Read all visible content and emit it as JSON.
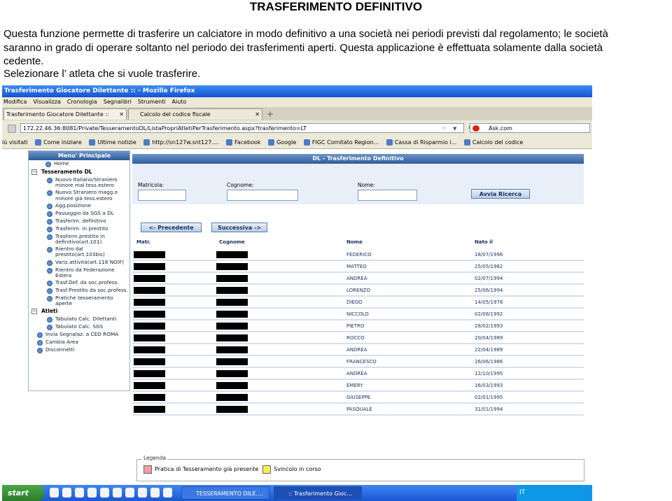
{
  "document": {
    "title": "TRASFERIMENTO DEFINITIVO",
    "paragraph_lines": [
      "Questa funzione permette di trasferire un calciatore in modo definitivo a una società nei periodi previsti dal regolamento; le società",
      "saranno in grado di operare soltanto nel periodo dei trasferimenti aperti. Questa applicazione è effettuata solamente dalla società",
      "cedente."
    ],
    "instruction": "Selezionare l’ atleta che si vuole trasferire."
  },
  "browser": {
    "window_title": "Trasferimento Giocatore Dilettante :: - Mozilla Firefox",
    "menu": [
      "Modifica",
      "Visualizza",
      "Cronologia",
      "Segnalibri",
      "Strumenti",
      "Aiuto"
    ],
    "tabs": [
      {
        "label": "Trasferimento Giocatore Dilettante ::",
        "close": "✕"
      },
      {
        "label": "Calcolo del codice fiscale",
        "close": "✕"
      }
    ],
    "url": "172.22.46.36:8081/Private/TesseramentoDL/ListaPropriAtletiPerTrasferimento.aspx?trasferimento=LT",
    "search_text": "Ask.com",
    "bookmarks": [
      "iù visitati",
      "Come iniziare",
      "Ultime notizie",
      "http://sn127w.snt127....",
      "Facebook",
      "Google",
      "FIGC Comitato Region...",
      "Cassa di Risparmio i...",
      "Calcolo del codice"
    ]
  },
  "sidebar": {
    "title": "Menu' Principale",
    "home": "Home",
    "groups": [
      {
        "label": "Tesseramento DL",
        "items": [
          "Nuovo Italiano/Straniero minore mai tess.estero",
          "Nuovo Straniero magg.o minore già tess.estero",
          "Agg.posizione",
          "Passaggio da SGS a DL",
          "Trasferim. definitivo",
          "Trasferim. in prestito",
          "Trasform.prestito in definitivo(art.101)",
          "Rientro dal prestito(art.103bis)",
          "Variz.attività(art.118 NOIF)",
          "Rientro da Federazione Estera",
          "Trasf.Def. da soc.profess.",
          "Trasf.Prestito da soc.profess.",
          "Pratiche tesseramento aperte"
        ]
      },
      {
        "label": "Atleti",
        "items": [
          "Tabulato Calc. Dilettanti",
          "Tabulato Calc. SGS"
        ]
      }
    ],
    "footer_items": [
      "Invia Segnalaz. a CED ROMA",
      "Cambia Area",
      "Disconnetti"
    ]
  },
  "main": {
    "header": "DL - Trasferimento Definitivo",
    "filters": {
      "matricola_label": "Matricola:",
      "cognome_label": "Cognome:",
      "nome_label": "Nome:"
    },
    "search_button": "Avvia Ricerca",
    "prev_button": "<- Precedente",
    "next_button": "Successiva ->",
    "columns": [
      "Matr.",
      "Cognome",
      "Nome",
      "Nato il"
    ],
    "rows": [
      {
        "nome": "FEDERICO",
        "nato": "18/07/1996"
      },
      {
        "nome": "MATTEO",
        "nato": "25/05/1982"
      },
      {
        "nome": "ANDREA",
        "nato": "02/07/1994"
      },
      {
        "nome": "LORENZO",
        "nato": "25/06/1994"
      },
      {
        "nome": "DIEGO",
        "nato": "14/05/1978"
      },
      {
        "nome": "NICCOLO",
        "nato": "02/08/1992"
      },
      {
        "nome": "PIETRO",
        "nato": "28/02/1993"
      },
      {
        "nome": "ROCCO",
        "nato": "20/04/1989"
      },
      {
        "nome": "ANDREA",
        "nato": "22/04/1989"
      },
      {
        "nome": "FRANCESCO",
        "nato": "26/06/1986"
      },
      {
        "nome": "ANDREA",
        "nato": "12/10/1995"
      },
      {
        "nome": "EMERY",
        "nato": "16/03/1993"
      },
      {
        "nome": "GIUSEPPE",
        "nato": "02/01/1995"
      },
      {
        "nome": "PASQUALE",
        "nato": "31/01/1994"
      }
    ]
  },
  "legend": {
    "title": "Legenda",
    "items": [
      {
        "label": "Pratica di Tesseramento già presente",
        "color": "#f49aa6"
      },
      {
        "label": "Svincolo in corso",
        "color": "#f4ee5a"
      }
    ]
  },
  "taskbar": {
    "start": "start",
    "buttons": [
      "TESSERAMENTO DILE....",
      ":: Trasferimento Gioc..."
    ],
    "tray_text": "IT"
  }
}
